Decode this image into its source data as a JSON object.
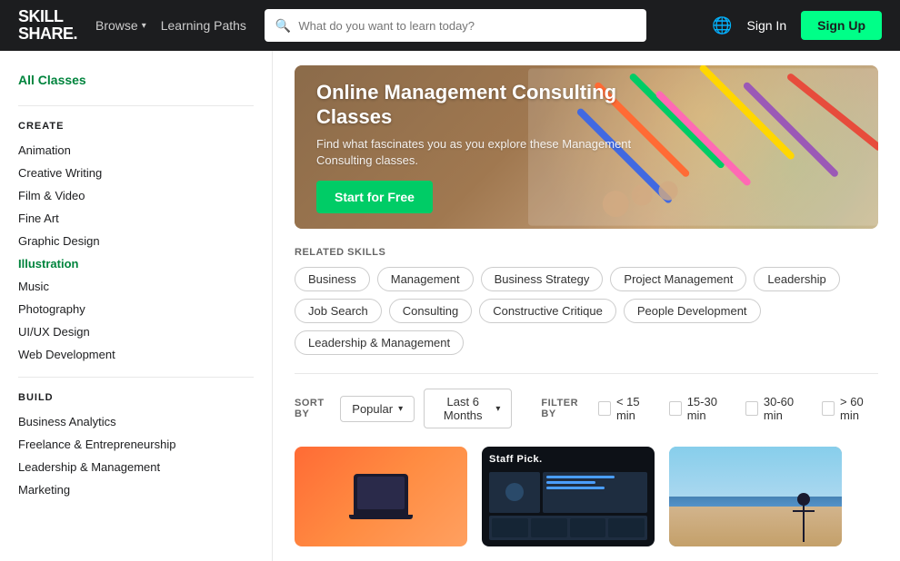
{
  "header": {
    "logo_skill": "SKILL",
    "logo_share": "SHARE.",
    "nav": [
      {
        "label": "Browse",
        "hasDropdown": true
      },
      {
        "label": "Learning Paths",
        "hasDropdown": false
      }
    ],
    "search_placeholder": "What do you want to learn today?",
    "sign_in_label": "Sign In",
    "sign_up_label": "Sign Up"
  },
  "sidebar": {
    "all_classes_label": "All Classes",
    "sections": [
      {
        "title": "CREATE",
        "items": [
          "Animation",
          "Creative Writing",
          "Film & Video",
          "Fine Art",
          "Graphic Design",
          "Illustration",
          "Music",
          "Photography",
          "UI/UX Design",
          "Web Development"
        ]
      },
      {
        "title": "BUILD",
        "items": [
          "Business Analytics",
          "Freelance & Entrepreneurship",
          "Leadership & Management",
          "Marketing"
        ]
      }
    ]
  },
  "hero": {
    "title": "Online Management Consulting Classes",
    "subtitle": "Find what fascinates you as you explore these Management Consulting classes.",
    "cta_label": "Start for Free"
  },
  "related_skills": {
    "header_label": "RELATED SKILLS",
    "tags": [
      "Business",
      "Management",
      "Business Strategy",
      "Project Management",
      "Leadership",
      "Job Search",
      "Consulting",
      "Constructive Critique",
      "People Development",
      "Leadership & Management"
    ]
  },
  "filters": {
    "sort_by_label": "SORT BY",
    "sort_options": [
      "Popular"
    ],
    "sort_selected": "Popular",
    "date_selected": "Last 6 Months",
    "filter_by_label": "FILTER BY",
    "duration_options": [
      {
        "label": "< 15 min",
        "checked": false
      },
      {
        "label": "15-30 min",
        "checked": false
      },
      {
        "label": "30-60 min",
        "checked": false
      },
      {
        "label": "> 60 min",
        "checked": false
      }
    ]
  },
  "courses": [
    {
      "type": "orange-laptop",
      "staff_pick": false
    },
    {
      "type": "dark-strategy",
      "staff_pick": true,
      "badge": "Staff Pick."
    },
    {
      "type": "beach",
      "staff_pick": false
    }
  ]
}
